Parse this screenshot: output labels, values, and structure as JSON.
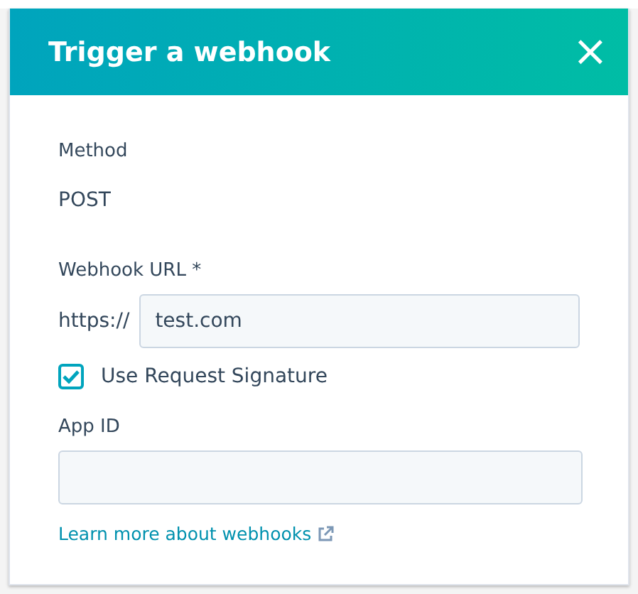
{
  "dialog": {
    "title": "Trigger a webhook",
    "close": "×"
  },
  "method": {
    "label": "Method",
    "value": "POST"
  },
  "webhook_url": {
    "label": "Webhook URL *",
    "prefix": "https://",
    "value": "test.com"
  },
  "request_signature": {
    "label": "Use Request Signature",
    "checked": true
  },
  "app_id": {
    "label": "App ID"
  },
  "link": {
    "text": "Learn more about webhooks"
  }
}
